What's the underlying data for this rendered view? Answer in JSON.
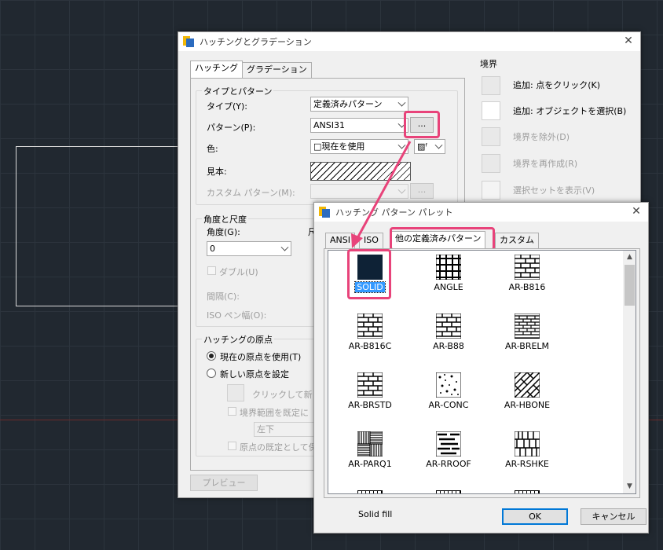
{
  "main": {
    "title": "ハッチングとグラデーション",
    "tabs": [
      "ハッチング",
      "グラデーション"
    ],
    "type_pattern": {
      "legend": "タイプとパターン",
      "type_label": "タイプ(Y):",
      "type_value": "定義済みパターン",
      "pattern_label": "パターン(P):",
      "pattern_value": "ANSI31",
      "browse": "...",
      "color_label": "色:",
      "color_value": "□現在を使用",
      "color_alt": "▨ᶠ",
      "swatch_label": "見本:",
      "custom_label": "カスタム パターン(M):",
      "custom_browse": "..."
    },
    "angle_scale": {
      "legend": "角度と尺度",
      "angle_label": "角度(G):",
      "angle_value": "0",
      "scale_label_fragment": "尺",
      "double_label": "ダブル(U)",
      "spacing_label": "間隔(C):",
      "iso_pen_label": "ISO ペン幅(O):"
    },
    "origin": {
      "legend": "ハッチングの原点",
      "use_current": "現在の原点を使用(T)",
      "set_new": "新しい原点を設定",
      "click_new": "クリックして新し",
      "default_extent": "境界範囲を既定に",
      "position_value": "左下",
      "store_default": "原点の既定として保"
    },
    "boundary": {
      "legend": "境界",
      "add_pick": "追加: 点をクリック(K)",
      "add_select": "追加: オブジェクトを選択(B)",
      "remove": "境界を除外(D)",
      "recreate": "境界を再作成(R)",
      "view_selection": "選択セットを表示(V)"
    },
    "preview": "プレビュー"
  },
  "palette": {
    "title": "ハッチング パターン パレット",
    "tabs": [
      "ANSI",
      "ISO",
      "他の定義済みパターン",
      "カスタム"
    ],
    "active_tab": 2,
    "patterns": [
      "SOLID",
      "ANGLE",
      "AR-B816",
      "AR-B816C",
      "AR-B88",
      "AR-BRELM",
      "AR-BRSTD",
      "AR-CONC",
      "AR-HBONE",
      "AR-PARQ1",
      "AR-RROOF",
      "AR-RSHKE"
    ],
    "selected": "SOLID",
    "description": "Solid fill",
    "ok": "OK",
    "cancel": "キャンセル"
  },
  "colors": {
    "highlight": "#e8437a",
    "solid_fill": "#0e2236",
    "selection": "#3399ff"
  }
}
